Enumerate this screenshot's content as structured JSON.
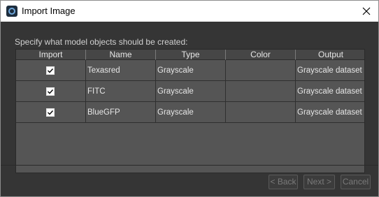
{
  "window": {
    "title": "Import Image",
    "icon": "app-logo-icon",
    "close_icon": "close-icon"
  },
  "prompt": "Specify what model objects should be created:",
  "table": {
    "columns": [
      "Import",
      "Name",
      "Type",
      "Color",
      "Output"
    ],
    "rows": [
      {
        "import": true,
        "name": "Texasred",
        "type": "Grayscale",
        "color": "",
        "output": "Grayscale dataset"
      },
      {
        "import": true,
        "name": "FITC",
        "type": "Grayscale",
        "color": "",
        "output": "Grayscale dataset"
      },
      {
        "import": true,
        "name": "BlueGFP",
        "type": "Grayscale",
        "color": "",
        "output": "Grayscale dataset"
      }
    ]
  },
  "buttons": {
    "back": "< Back",
    "next": "Next >",
    "cancel": "Cancel"
  },
  "colors": {
    "background": "#353535",
    "table_background": "#555555",
    "header_background": "#464646",
    "text": "#e6e6e6",
    "disabled_text": "#7a7a7a"
  }
}
